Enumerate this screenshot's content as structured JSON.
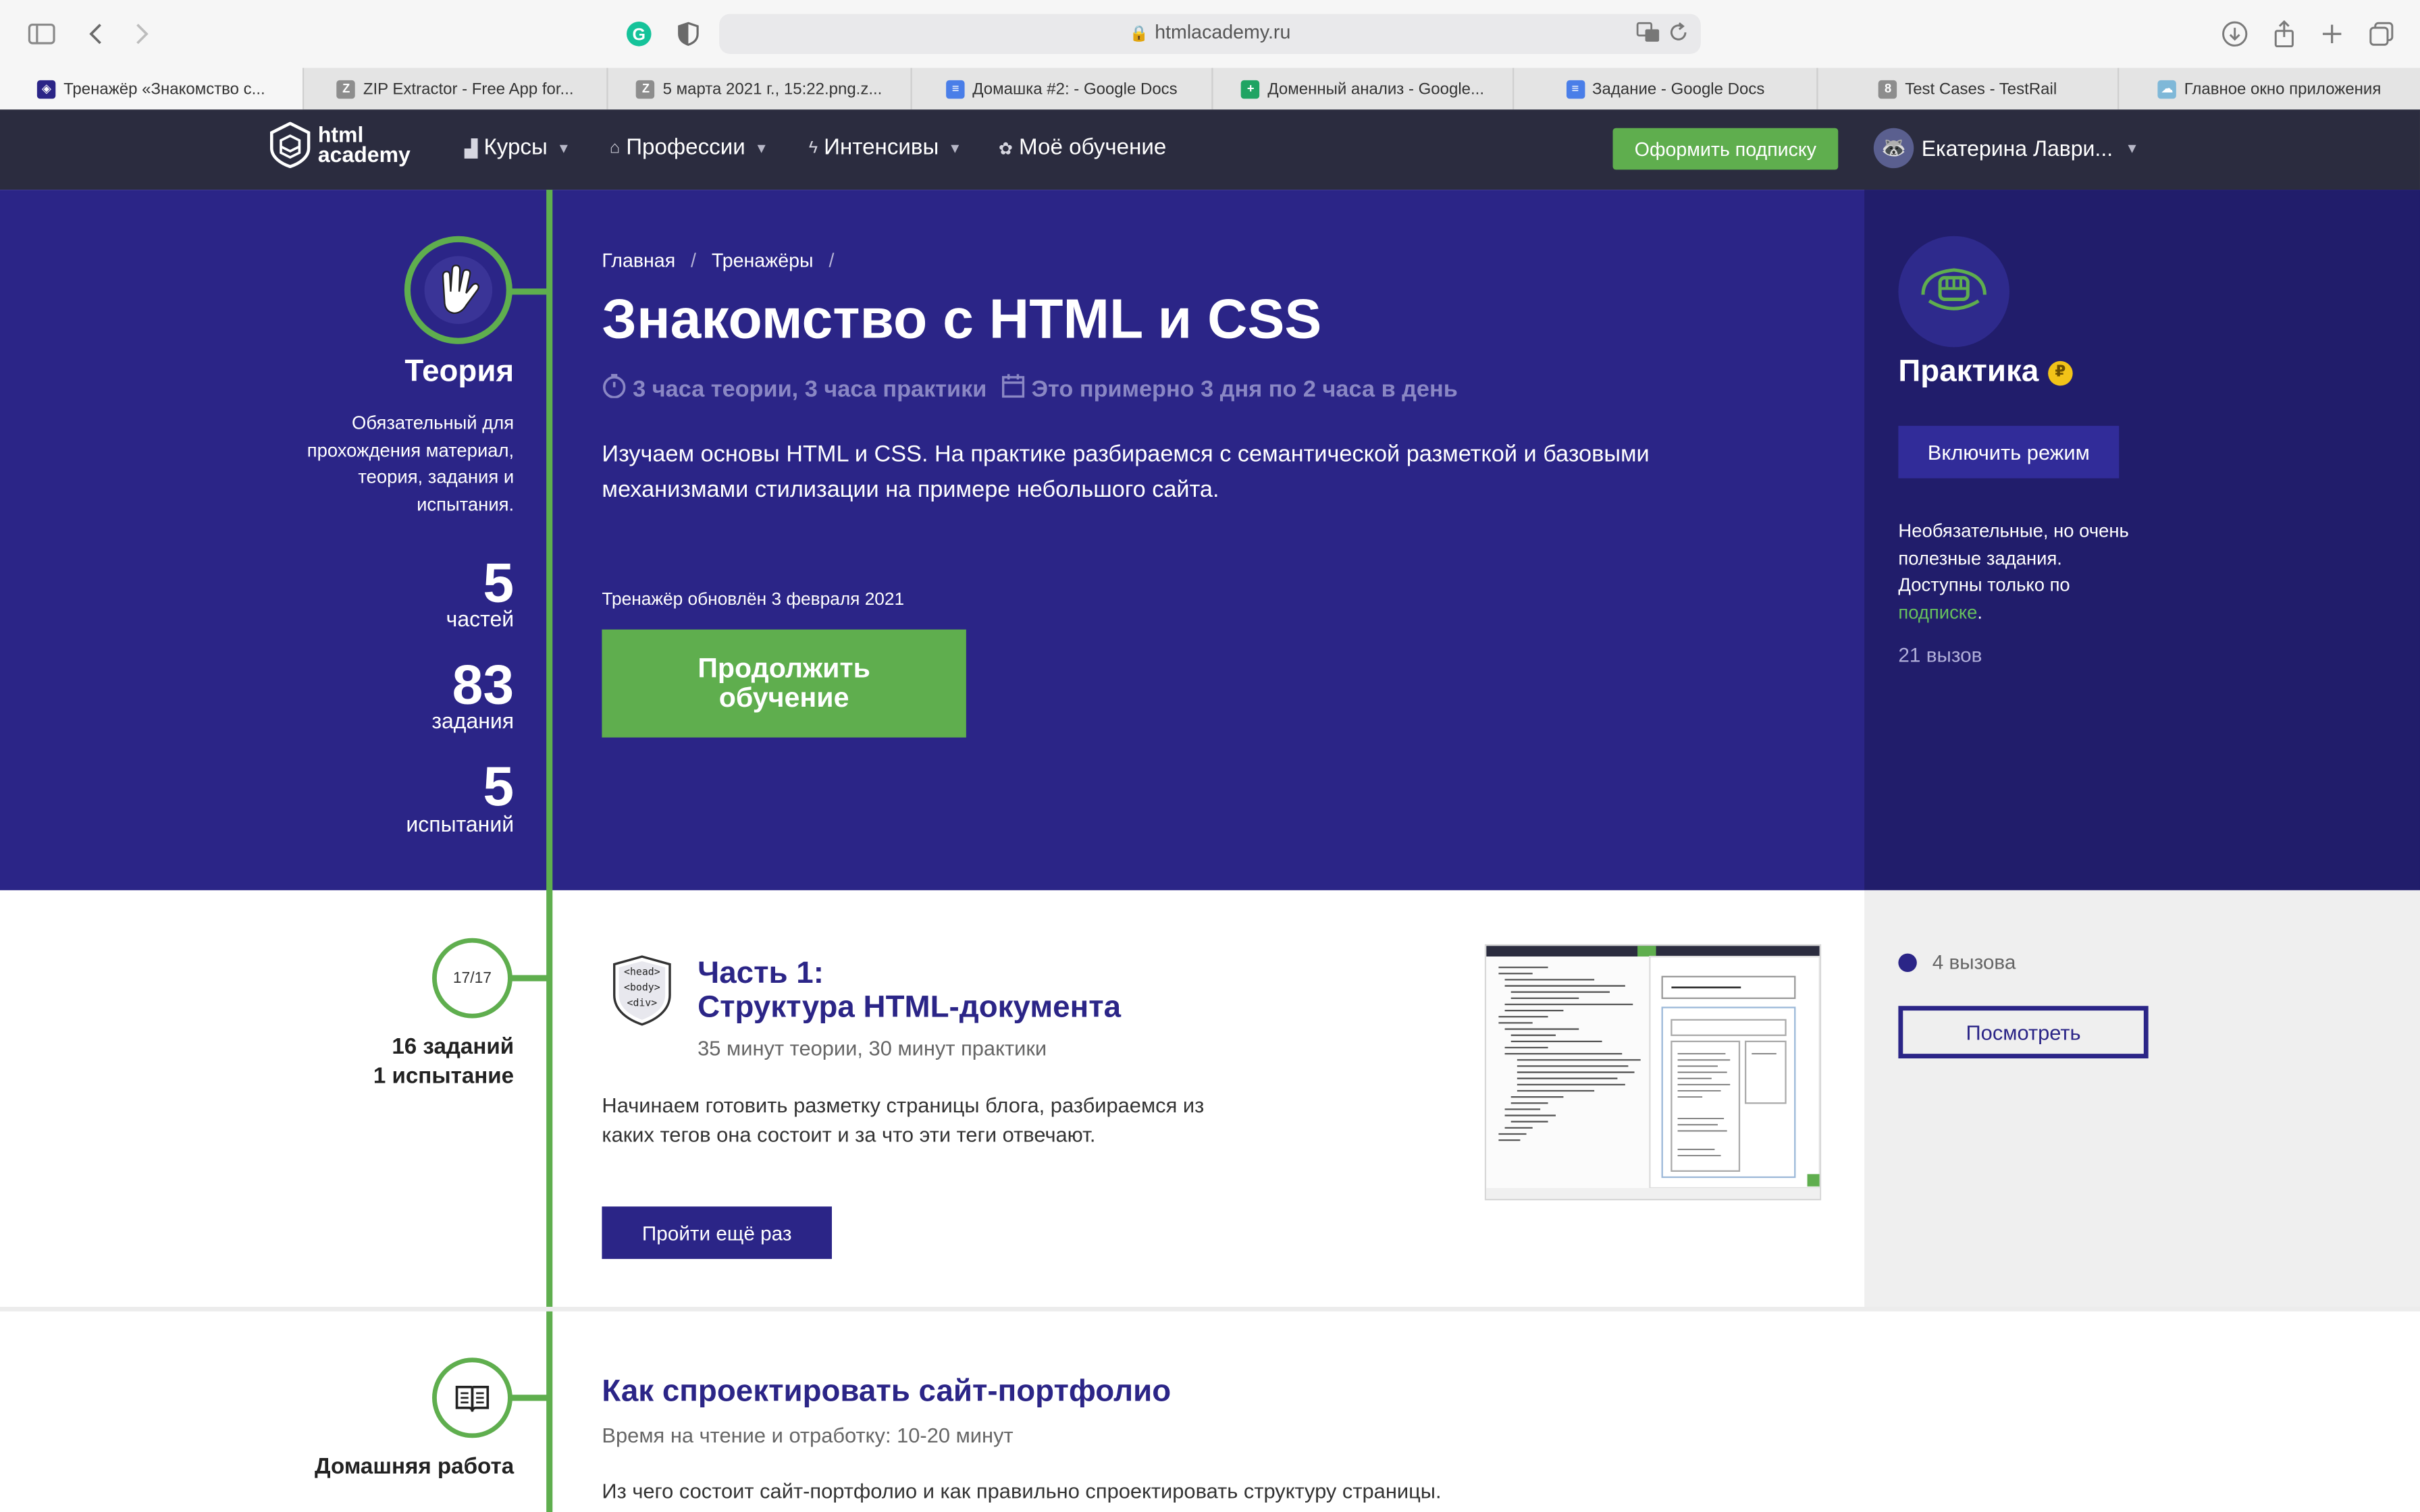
{
  "browser": {
    "url": "htmlacademy.ru",
    "tabs": [
      {
        "title": "Тренажёр «Знакомство с...",
        "active": true
      },
      {
        "title": "ZIP Extractor - Free App for..."
      },
      {
        "title": "5 марта 2021 г., 15:22.png.z..."
      },
      {
        "title": "Домашка #2: - Google Docs"
      },
      {
        "title": "Доменный анализ - Google..."
      },
      {
        "title": "Задание - Google Docs"
      },
      {
        "title": "Test Cases - TestRail"
      },
      {
        "title": "Главное окно приложения"
      }
    ]
  },
  "header": {
    "logo_line1": "html",
    "logo_line2": "academy",
    "nav": {
      "courses": "Курсы",
      "professions": "Профессии",
      "intensives": "Интенсивы",
      "my_learning": "Моё обучение"
    },
    "subscribe": "Оформить подписку",
    "user_name": "Екатерина Лаври..."
  },
  "theory": {
    "title": "Теория",
    "description": "Обязательный для прохождения материал, теория, задания и испытания.",
    "stats": [
      {
        "value": "5",
        "label": "частей"
      },
      {
        "value": "83",
        "label": "задания"
      },
      {
        "value": "5",
        "label": "испытаний"
      }
    ]
  },
  "hero": {
    "breadcrumb": {
      "home": "Главная",
      "section": "Тренажёры",
      "sep": "/"
    },
    "title": "Знакомство с HTML и CSS",
    "duration": "3 часа теории, 3 часа практики",
    "schedule": "Это примерно 3 дня по 2 часа в день",
    "description": "Изучаем основы HTML и CSS. На практике разбираемся с семантической разметкой и базовыми механизмами стилизации на примере небольшого сайта.",
    "updated": "Тренажёр обновлён 3 февраля 2021",
    "continue": "Продолжить обучение"
  },
  "practice": {
    "title": "Практика",
    "coin": "₽",
    "enable": "Включить режим",
    "desc_before": "Необязательные, но очень полезные задания. Доступны только по ",
    "desc_link": "подписке",
    "desc_after": ".",
    "challenges": "21 вызов"
  },
  "part1": {
    "progress": "17/17",
    "stats_line1": "16 заданий",
    "stats_line2": "1 испытание",
    "shield_tags": [
      "<head>",
      "<body>",
      "<div>"
    ],
    "title_line1": "Часть 1:",
    "title_line2": "Структура HTML-документа",
    "meta": "35 минут теории, 30 минут практики",
    "description": "Начинаем готовить разметку страницы блога, разбираемся из каких тегов она состоит и за что эти теги отвечают.",
    "retry": "Пройти ещё раз",
    "challenges": "4 вызова",
    "view": "Посмотреть"
  },
  "homework": {
    "label": "Домашняя работа",
    "title": "Как спроектировать сайт-портфолио",
    "meta": "Время на чтение и отработку: 10-20 минут",
    "description": "Из чего состоит сайт-портфолио и как правильно спроектировать структуру страницы."
  },
  "colors": {
    "hero": "#2b2587",
    "hero_right": "#211d6b",
    "accent_green": "#5fae4e",
    "header": "#2b2c3f"
  },
  "icons": [
    "sidebar-icon",
    "back-icon",
    "forward-icon",
    "grammarly-icon",
    "shield-privacy-icon",
    "lock-icon",
    "translate-icon",
    "reload-icon",
    "download-icon",
    "share-icon",
    "plus-icon",
    "tabs-icon",
    "hand-icon",
    "fist-icon",
    "clock-icon",
    "calendar-icon",
    "book-icon"
  ]
}
